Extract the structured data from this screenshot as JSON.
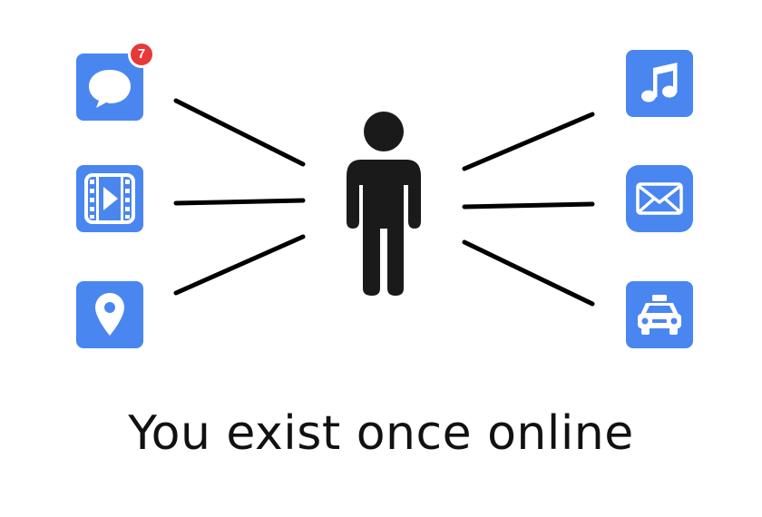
{
  "caption": "You exist once online",
  "person_icon": "person-icon",
  "colors": {
    "tile": "#4a86f0",
    "badge": "#e5393a",
    "person": "#1a1a1a",
    "line": "#000000"
  },
  "left_apps": [
    {
      "icon": "chat-icon",
      "badge": "7"
    },
    {
      "icon": "video-icon"
    },
    {
      "icon": "map-pin-icon"
    }
  ],
  "right_apps": [
    {
      "icon": "music-note-icon"
    },
    {
      "icon": "mail-icon"
    },
    {
      "icon": "taxi-icon"
    }
  ]
}
